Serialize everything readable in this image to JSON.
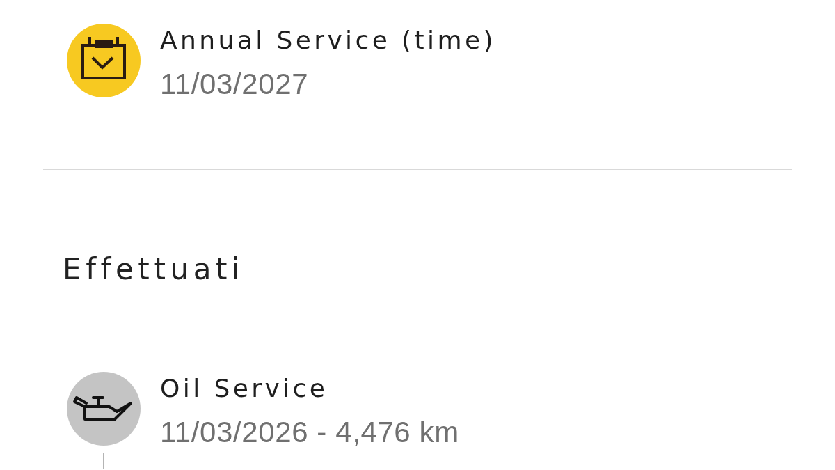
{
  "upcoming": [
    {
      "kind": "calendar",
      "color": "#f7c921",
      "title": "Annual Service (time)",
      "detail": "11/03/2027"
    }
  ],
  "completed": {
    "heading": "Effettuati",
    "items": [
      {
        "kind": "oil",
        "color": "#c4c4c4",
        "title": "Oil Service",
        "detail": "11/03/2026 - 4,476 km",
        "continues": true
      }
    ]
  }
}
